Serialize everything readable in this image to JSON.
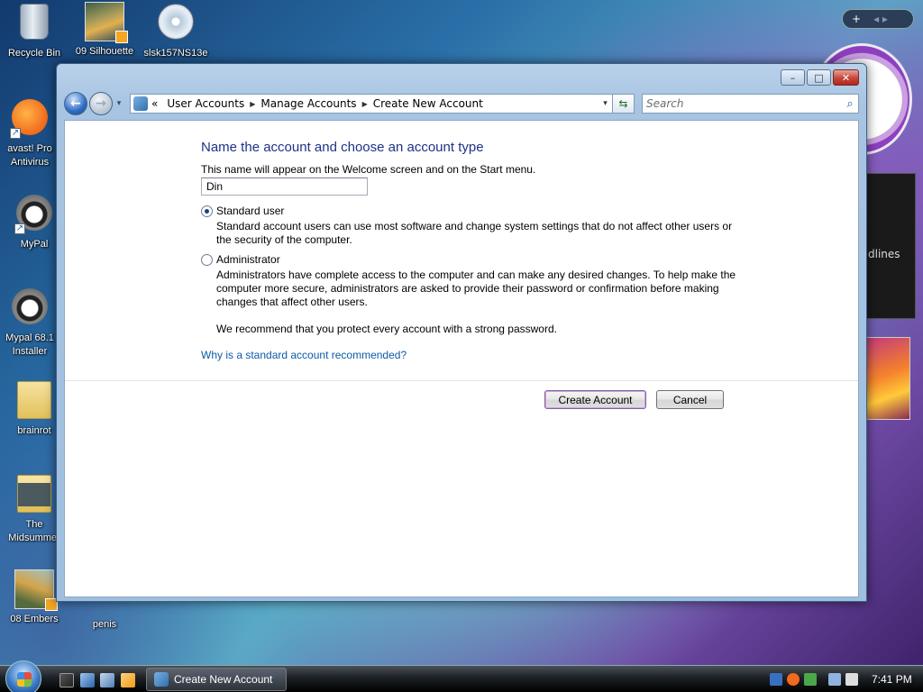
{
  "desktop": {
    "icons": [
      {
        "label": "Recycle Bin",
        "icon": "recycle-bin-icon"
      },
      {
        "label": "09 Silhouette",
        "icon": "video-file-icon"
      },
      {
        "label": "slsk157NS13e",
        "icon": "installer-icon"
      },
      {
        "label": "avast! Pro Antivirus",
        "icon": "avast-icon"
      },
      {
        "label": "MyPal",
        "icon": "mypal-icon"
      },
      {
        "label": "Mypal 68.1 Installer",
        "icon": "mypal-installer-icon"
      },
      {
        "label": "brainrot",
        "icon": "folder-icon"
      },
      {
        "label": "The Midsummer",
        "icon": "folder-icon"
      },
      {
        "label": "08 Embers",
        "icon": "video-file-icon"
      },
      {
        "label": "penis",
        "icon": "shortcut-icon"
      }
    ]
  },
  "sidebar": {
    "add_symbol": "+",
    "nav_symbols": "◂ ▸",
    "feed_text": "dlines"
  },
  "window": {
    "minimize": "–",
    "maximize": "□",
    "close": "✕",
    "nav": {
      "back_icon": "←",
      "forward_icon": "→",
      "dropdown_icon": "▾"
    },
    "address": {
      "overflow": "«",
      "crumbs": [
        "User Accounts",
        "Manage Accounts",
        "Create New Account"
      ],
      "separator": "▶",
      "dropdown": "▾",
      "refresh": "⇆"
    },
    "search": {
      "placeholder": "Search",
      "icon": "⌕"
    }
  },
  "form": {
    "heading": "Name the account and choose an account type",
    "description": "This name will appear on the Welcome screen and on the Start menu.",
    "name_value": "Din",
    "options": [
      {
        "label": "Standard user",
        "selected": true,
        "text": "Standard account users can use most software and change system settings that do not affect other users or the security of the computer."
      },
      {
        "label": "Administrator",
        "selected": false,
        "text": "Administrators have complete access to the computer and can make any desired changes. To help make the computer more secure, administrators are asked to provide their password or confirmation before making changes that affect other users."
      }
    ],
    "recommendation": "We recommend that you protect every account with a strong password.",
    "help_link": "Why is a standard account recommended?",
    "create_button": "Create Account",
    "cancel_button": "Cancel"
  },
  "taskbar": {
    "task_label": "Create New Account",
    "clock": "7:41 PM"
  }
}
